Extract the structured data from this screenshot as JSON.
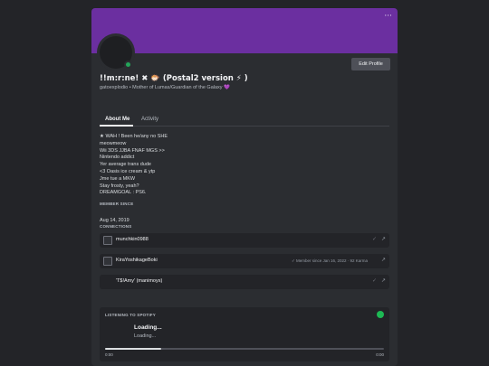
{
  "header": {
    "more_label": "···"
  },
  "profile": {
    "display_name": "!!m:r:ne! ✖ 🐡 (Postal2 version ⚡ )",
    "subtitle": "gatoexplodio • Mother of Lumas/Guardian of the Galaxy 💜",
    "edit_button": "Edit Profile",
    "status_color": "#23a559",
    "banner_color": "#6b2fa0"
  },
  "tabs": [
    {
      "label": "About Me",
      "active": true
    },
    {
      "label": "Activity",
      "active": false
    }
  ],
  "bio": [
    "★ WAH ! Been he/any no SHE",
    "meowmeow",
    "Wii 3DS JJBA FNAF MGS >>",
    "Nintendo addict",
    "Yer average trans dude",
    "<3 Oasis ice cream & ytp",
    "Jme tue a MKW",
    "Stay frosty, yeah?",
    "DREAMGOAL : PS6."
  ],
  "member_since": {
    "label": "MEMBER SINCE",
    "value": "Aug 14, 2019"
  },
  "connections": {
    "label": "CONNECTIONS",
    "items": [
      {
        "name": "munchkin0988",
        "meta": "",
        "check": "✓",
        "arrow": "↗"
      },
      {
        "name": "KiraYoshikageBoki",
        "meta": "✓          Member since Jan 16, 2022 · 92 Karma",
        "check": "✓",
        "arrow": "↗"
      },
      {
        "name": "'T$!Amy' (manimoys)",
        "meta": "",
        "check": "✓",
        "arrow": "↗"
      }
    ]
  },
  "spotify": {
    "label": "LISTENING TO SPOTIFY",
    "title": "Loading...",
    "subtitle": "Loading...",
    "progress": 0.2,
    "time_start": "0:00",
    "time_end": "0:00",
    "brand_color": "#1db954"
  }
}
